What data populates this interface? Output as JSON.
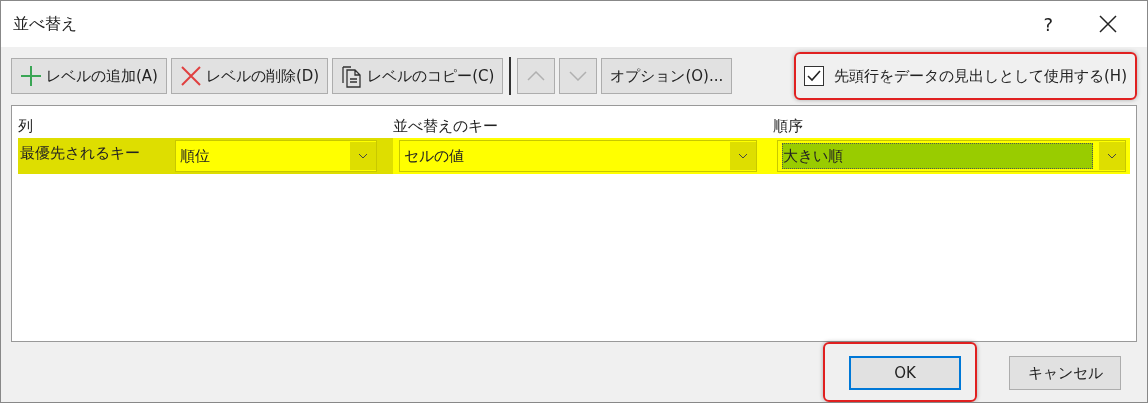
{
  "window": {
    "title": "並べ替え",
    "help": "?"
  },
  "toolbar": [
    {
      "kind": "add",
      "label": "レベルの追加(A)",
      "disabled": false
    },
    {
      "kind": "delete",
      "label": "レベルの削除(D)",
      "disabled": false
    },
    {
      "kind": "copy",
      "label": "レベルのコピー(C)",
      "disabled": false
    },
    {
      "kind": "up",
      "disabled": true
    },
    {
      "kind": "down",
      "disabled": true
    },
    {
      "kind": "text",
      "label": "オプション(O)...",
      "disabled": false
    }
  ],
  "header_checkbox": {
    "label": "先頭行をデータの見出しとして使用する(H)",
    "checked": true,
    "annotated": true
  },
  "table": {
    "columns": [
      "列",
      "並べ替えのキー",
      "順序"
    ],
    "rows": [
      {
        "label": "最優先されるキー",
        "highlighted": true,
        "column": "順位",
        "key": "セルの値",
        "order": "大きい順",
        "order_selected": true
      }
    ]
  },
  "buttons": [
    {
      "label": "OK",
      "default": true,
      "annotated": true
    },
    {
      "label": "キャンセル",
      "default": false,
      "annotated": false
    }
  ]
}
